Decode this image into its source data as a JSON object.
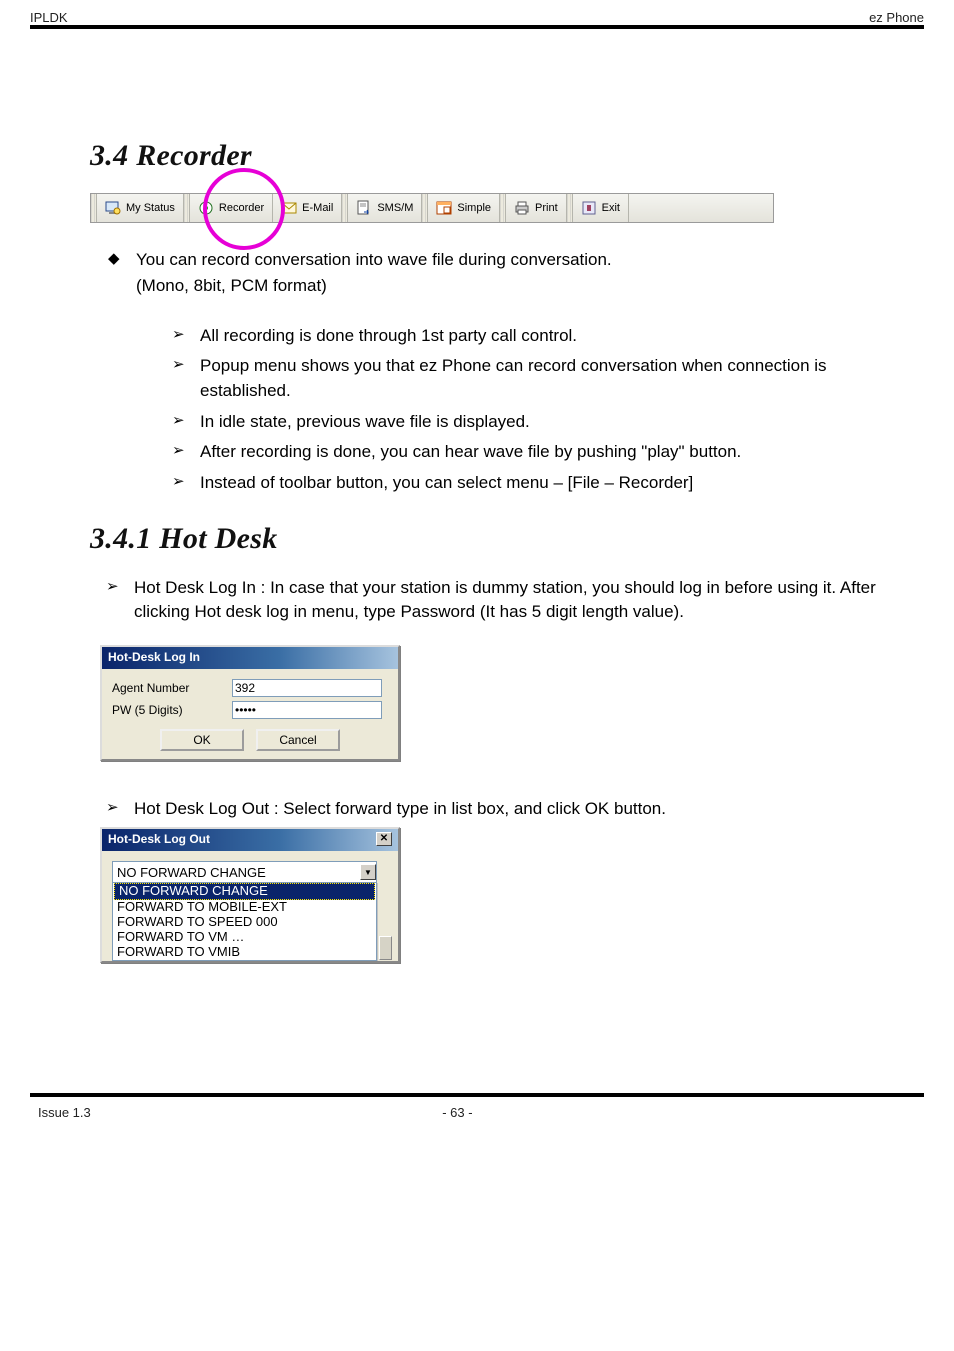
{
  "header": {
    "left": "IPLDK",
    "right": "ez Phone"
  },
  "section": {
    "title": "3.4    Recorder"
  },
  "toolbar": {
    "items": [
      {
        "label": "My Status"
      },
      {
        "label": "Recorder"
      },
      {
        "label": "E-Mail"
      },
      {
        "label": "SMS/M"
      },
      {
        "label": "Simple"
      },
      {
        "label": "Print"
      },
      {
        "label": "Exit"
      }
    ]
  },
  "intro": {
    "diamond_item": "You can record conversation into wave file during conversation.",
    "diamond_sub": "(Mono, 8bit, PCM format)",
    "arrow_items": [
      "All recording is done through 1st party call control.",
      "Popup menu shows you that ez Phone can record conversation when connection is established.",
      "In idle state, previous wave file is displayed.",
      "After recording is done, you can hear wave file by pushing \"play\" button.",
      "Instead of toolbar button, you can select menu – [File – Recorder]"
    ]
  },
  "hotdesk": {
    "heading": "3.4.1     Hot Desk",
    "login_para_arrow": "Hot Desk Log In :  In case that your station is dummy station, you should log in before using it. After clicking Hot desk log in menu, type Password (It has 5 digit length value).",
    "login_dialog": {
      "title": "Hot-Desk Log In",
      "agent_label": "Agent Number",
      "agent_value": "392",
      "pw_label": "PW (5 Digits)",
      "pw_value": "*****",
      "ok_label": "OK",
      "cancel_label": "Cancel"
    },
    "logout_arrow": "Hot Desk Log Out : Select forward type in list box, and click OK button.",
    "logout_dialog": {
      "title": "Hot-Desk Log Out",
      "selected": "NO FORWARD CHANGE",
      "options": [
        "NO FORWARD CHANGE",
        "FORWARD TO MOBILE-EXT",
        "FORWARD TO SPEED 000",
        "FORWARD TO VM …",
        "FORWARD TO VMIB"
      ]
    }
  },
  "footer": {
    "issue": "Issue 1.3",
    "page": "- 63 -"
  }
}
